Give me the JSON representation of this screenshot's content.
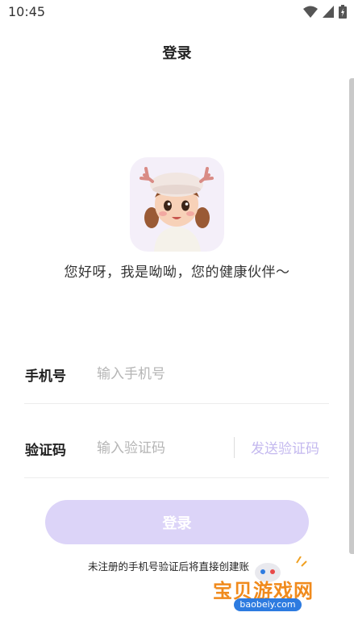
{
  "status_bar": {
    "time": "10:45"
  },
  "header": {
    "title": "登录"
  },
  "greeting": "您好呀，我是呦呦，您的健康伙伴～",
  "form": {
    "phone_label": "手机号",
    "phone_placeholder": "输入手机号",
    "phone_value": "",
    "code_label": "验证码",
    "code_placeholder": "输入验证码",
    "code_value": "",
    "send_code_label": "发送验证码"
  },
  "login_button": "登录",
  "agreement_text": "未注册的手机号验证后将直接创建账",
  "watermark": {
    "name": "宝贝游戏网",
    "url": "baobeiy.com"
  },
  "colors": {
    "accent": "#dcd4f8",
    "send_code": "#c4b9ef",
    "avatar_bg": "#f4eff9"
  },
  "icons": [
    "wifi-icon",
    "signal-icon",
    "battery-icon",
    "avatar-girl-icon"
  ]
}
